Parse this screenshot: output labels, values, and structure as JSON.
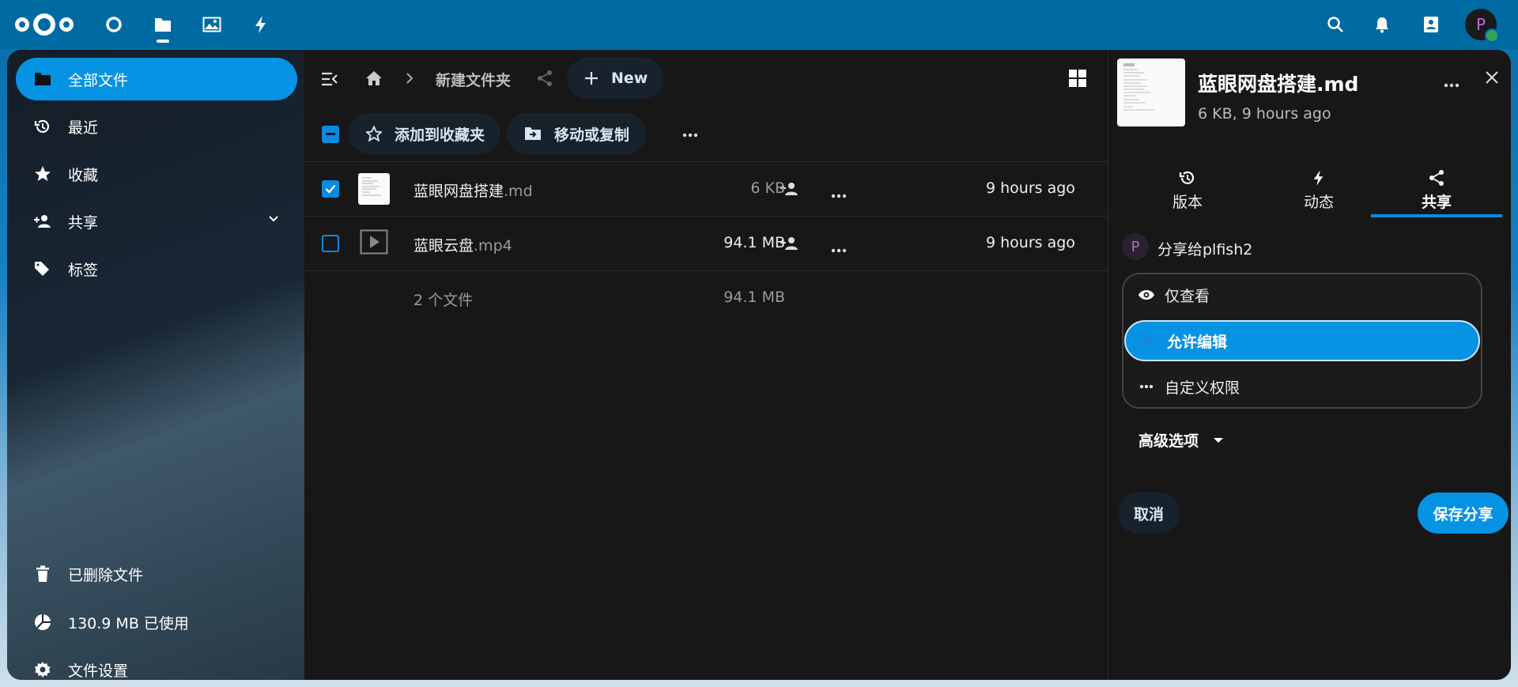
{
  "header": {
    "apps": [
      "dashboard-icon",
      "files-icon",
      "photos-icon",
      "activity-icon"
    ],
    "right_icons": [
      "search-icon",
      "bell-icon",
      "contacts-icon"
    ],
    "avatar_initial": "P"
  },
  "sidebar": {
    "items": [
      {
        "label": "全部文件",
        "icon": "folder-icon"
      },
      {
        "label": "最近",
        "icon": "history-icon"
      },
      {
        "label": "收藏",
        "icon": "star-icon"
      },
      {
        "label": "共享",
        "icon": "share-user-icon"
      },
      {
        "label": "标签",
        "icon": "tag-icon"
      }
    ],
    "bottom": {
      "trash": "已删除文件",
      "quota": "130.9 MB 已使用",
      "settings": "文件设置"
    }
  },
  "main": {
    "breadcrumb": {
      "folder": "新建文件夹"
    },
    "new_button": "New",
    "actions": {
      "favorite": "添加到收藏夹",
      "move_copy": "移动或复制"
    },
    "files": [
      {
        "name": "蓝眼网盘搭建",
        "ext": ".md",
        "size": "6 KB",
        "modified": "9 hours ago",
        "checked": true
      },
      {
        "name": "蓝眼云盘",
        "ext": ".mp4",
        "size": "94.1 MB",
        "modified": "9 hours ago",
        "checked": false
      }
    ],
    "summary": {
      "count": "2 个文件",
      "total": "94.1 MB"
    }
  },
  "sidepanel": {
    "title": "蓝眼网盘搭建.md",
    "meta": "6 KB, 9 hours ago",
    "tabs": [
      {
        "label": "版本",
        "icon": "history-icon"
      },
      {
        "label": "动态",
        "icon": "activity-icon"
      },
      {
        "label": "共享",
        "icon": "share-icon"
      }
    ],
    "share_with": "分享给plfish2",
    "share_avatar": "P",
    "permissions": [
      {
        "label": "仅查看",
        "icon": "eye-icon"
      },
      {
        "label": "允许编辑",
        "icon": "pencil-icon"
      },
      {
        "label": "自定义权限",
        "icon": "dots-icon"
      }
    ],
    "advanced": "高级选项",
    "cancel": "取消",
    "save": "保存分享"
  }
}
